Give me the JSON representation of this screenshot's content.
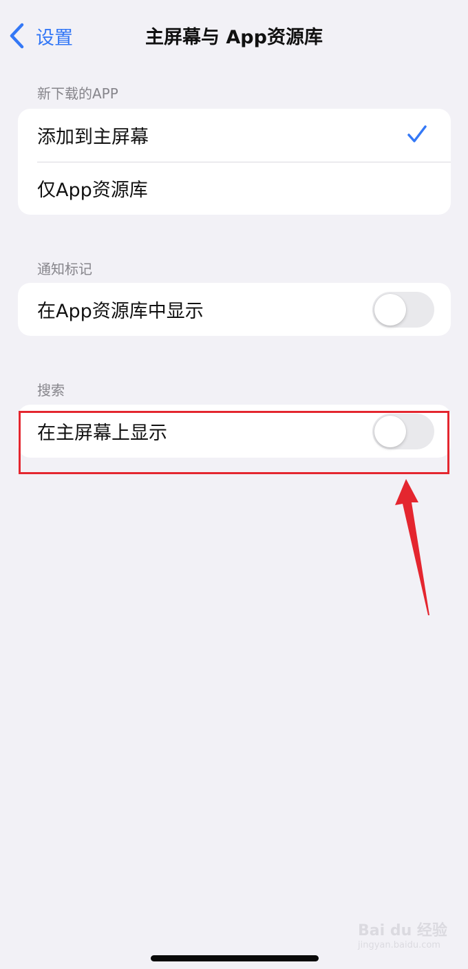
{
  "nav": {
    "back_label": "设置",
    "title": "主屏幕与 App资源库"
  },
  "sections": [
    {
      "header": "新下载的APP",
      "rows": [
        {
          "label": "添加到主屏幕",
          "selected": true
        },
        {
          "label": "仅App资源库",
          "selected": false
        }
      ]
    },
    {
      "header": "通知标记",
      "rows": [
        {
          "label": "在App资源库中显示",
          "toggle_on": false
        }
      ]
    },
    {
      "header": "搜索",
      "rows": [
        {
          "label": "在主屏幕上显示",
          "toggle_on": false
        }
      ]
    }
  ],
  "colors": {
    "accent": "#3478f6",
    "background": "#f2f1f6",
    "annotation": "#e4262f",
    "toggle_off": "#e9e9ec"
  },
  "watermark": {
    "brand": "Bai du 经验",
    "sub": "jingyan.baidu.com"
  }
}
